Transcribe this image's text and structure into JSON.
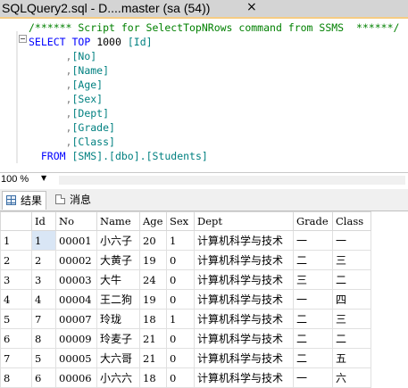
{
  "tab": {
    "title": "SQLQuery2.sql - D....master (sa (54))",
    "close": "×"
  },
  "editor": {
    "comment": "/****** Script for SelectTopNRows command from SSMS  ******/",
    "select_kw": "SELECT",
    "top_kw": "TOP",
    "top_n": "1000",
    "first_col": "[Id]",
    "columns": [
      "[No]",
      "[Name]",
      "[Age]",
      "[Sex]",
      "[Dept]",
      "[Grade]",
      "[Class]"
    ],
    "from_kw": "FROM",
    "from_target": "[SMS].[dbo].[Students]"
  },
  "zoom": {
    "value": "100 %"
  },
  "results_tabs": [
    {
      "label": "结果"
    },
    {
      "label": "消息"
    }
  ],
  "grid": {
    "headers": [
      "Id",
      "No",
      "Name",
      "Age",
      "Sex",
      "Dept",
      "Grade",
      "Class"
    ],
    "rows": [
      {
        "rownum": "1",
        "cells": [
          "1",
          "00001",
          "小六子",
          "20",
          "1",
          "计算机科学与技术",
          "一",
          "一"
        ]
      },
      {
        "rownum": "2",
        "cells": [
          "2",
          "00002",
          "大黄子",
          "19",
          "0",
          "计算机科学与技术",
          "二",
          "三"
        ]
      },
      {
        "rownum": "3",
        "cells": [
          "3",
          "00003",
          "大牛",
          "24",
          "0",
          "计算机科学与技术",
          "三",
          "二"
        ]
      },
      {
        "rownum": "4",
        "cells": [
          "4",
          "00004",
          "王二狗",
          "19",
          "0",
          "计算机科学与技术",
          "一",
          "四"
        ]
      },
      {
        "rownum": "5",
        "cells": [
          "7",
          "00007",
          "玲珑",
          "18",
          "1",
          "计算机科学与技术",
          "二",
          "三"
        ]
      },
      {
        "rownum": "6",
        "cells": [
          "8",
          "00009",
          "玲麦子",
          "21",
          "0",
          "计算机科学与技术",
          "二",
          "二"
        ]
      },
      {
        "rownum": "7",
        "cells": [
          "5",
          "00005",
          "大六哥",
          "21",
          "0",
          "计算机科学与技术",
          "二",
          "五"
        ]
      },
      {
        "rownum": "8",
        "cells": [
          "6",
          "00006",
          "小六六",
          "18",
          "0",
          "计算机科学与技术",
          "一",
          "六"
        ]
      }
    ]
  }
}
